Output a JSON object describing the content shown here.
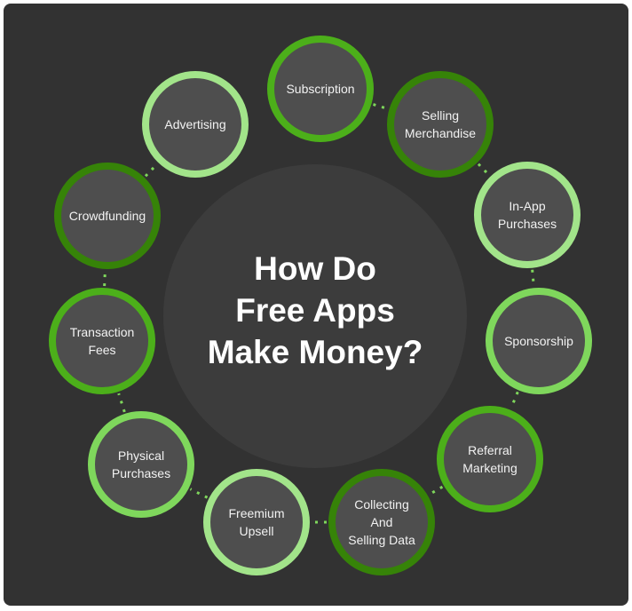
{
  "diagram": {
    "title": "How Do\nFree Apps\nMake Money?",
    "colors": {
      "background": "#323232",
      "center_fill": "#3c3c3c",
      "node_fill": "#4e4e4e",
      "ring_dark": "#368308",
      "ring_medium": "#4caf1a",
      "ring_light": "#7fd75c",
      "ring_pale": "#a2e48a",
      "connector": "#7fd75c",
      "text": "#f2f2f2"
    },
    "nodes": [
      {
        "id": "subscription",
        "label": "Subscription",
        "ring": "ring_medium"
      },
      {
        "id": "selling-merchandise",
        "label": "Selling\nMerchandise",
        "ring": "ring_dark"
      },
      {
        "id": "in-app-purchases",
        "label": "In-App\nPurchases",
        "ring": "ring_pale"
      },
      {
        "id": "sponsorship",
        "label": "Sponsorship",
        "ring": "ring_light"
      },
      {
        "id": "referral-marketing",
        "label": "Referral\nMarketing",
        "ring": "ring_medium"
      },
      {
        "id": "collecting-and-selling-data",
        "label": "Collecting\nAnd\nSelling Data",
        "ring": "ring_dark"
      },
      {
        "id": "freemium-upsell",
        "label": "Freemium\nUpsell",
        "ring": "ring_pale"
      },
      {
        "id": "physical-purchases",
        "label": "Physical\nPurchases",
        "ring": "ring_light"
      },
      {
        "id": "transaction-fees",
        "label": "Transaction\nFees",
        "ring": "ring_medium"
      },
      {
        "id": "crowdfunding",
        "label": "Crowdfunding",
        "ring": "ring_dark"
      },
      {
        "id": "advertising",
        "label": "Advertising",
        "ring": "ring_pale"
      }
    ]
  }
}
